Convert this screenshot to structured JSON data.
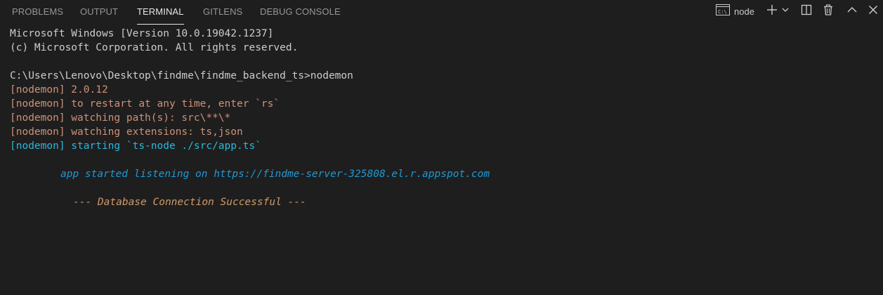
{
  "tabs": [
    {
      "label": "PROBLEMS"
    },
    {
      "label": "OUTPUT"
    },
    {
      "label": "TERMINAL"
    },
    {
      "label": "GITLENS"
    },
    {
      "label": "DEBUG CONSOLE"
    }
  ],
  "active_tab": "TERMINAL",
  "actions": {
    "terminal_name": "node",
    "icons": [
      "terminal-icon",
      "plus-icon",
      "chevron-down-icon",
      "split-icon",
      "trash-icon",
      "chevron-up-icon",
      "close-icon"
    ]
  },
  "terminal": {
    "lines": [
      {
        "text": "Microsoft Windows [Version 10.0.19042.1237]",
        "color": "#cccccc"
      },
      {
        "text": "(c) Microsoft Corporation. All rights reserved.",
        "color": "#cccccc"
      },
      {
        "text": "",
        "color": "#cccccc"
      },
      {
        "text": "C:\\Users\\Lenovo\\Desktop\\findme\\findme_backend_ts>nodemon",
        "color": "#cccccc"
      },
      {
        "text": "[nodemon] 2.0.12",
        "color": "#ce9178"
      },
      {
        "text": "[nodemon] to restart at any time, enter `rs`",
        "color": "#ce9178"
      },
      {
        "text": "[nodemon] watching path(s): src\\**\\*",
        "color": "#ce9178"
      },
      {
        "text": "[nodemon] watching extensions: ts,json",
        "color": "#ce9178"
      },
      {
        "text": "[nodemon] starting `ts-node ./src/app.ts`",
        "color": "#29b8db"
      },
      {
        "text": "",
        "color": "#cccccc"
      },
      {
        "text": "app started listening on https://findme-server-325808.el.r.appspot.com",
        "color": "#1c9ad6"
      },
      {
        "text": "",
        "color": "#cccccc"
      },
      {
        "text": "--- Database Connection Successful ---",
        "color": "#d19a66"
      }
    ]
  },
  "colors": {
    "background": "#1e1e1e",
    "tab_inactive": "#969696",
    "tab_active": "#e7e7e7",
    "text_default": "#cccccc",
    "nodemon_orange": "#ce9178",
    "nodemon_cyan": "#29b8db",
    "server_blue": "#1c9ad6",
    "db_orange": "#d19a66"
  }
}
